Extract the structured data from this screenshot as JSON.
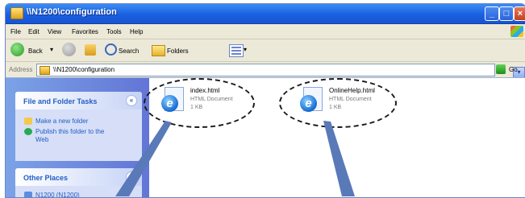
{
  "window": {
    "title": "\\\\N1200\\configuration"
  },
  "menu": [
    "File",
    "Edit",
    "View",
    "Favorites",
    "Tools",
    "Help"
  ],
  "toolbar": {
    "back_label": "Back",
    "search_label": "Search",
    "folders_label": "Folders"
  },
  "address": {
    "label": "Address",
    "value": "\\\\N1200\\configuration",
    "go_label": "Go"
  },
  "sidebar": {
    "tasks_title": "File and Folder Tasks",
    "tasks": [
      "Make a new folder",
      "Publish this folder to the",
      "Web"
    ],
    "places_title": "Other Places",
    "places": [
      "N1200 (N1200)"
    ]
  },
  "files": [
    {
      "name": "index.html",
      "type": "HTML Document",
      "size": "1 KB"
    },
    {
      "name": "OnlineHelp.html",
      "type": "HTML Document",
      "size": "1 KB"
    }
  ],
  "colors": {
    "titlebar": "#1a5fe0",
    "sidebar": "#6375d6",
    "annotation_arrow": "#5a79b8"
  }
}
